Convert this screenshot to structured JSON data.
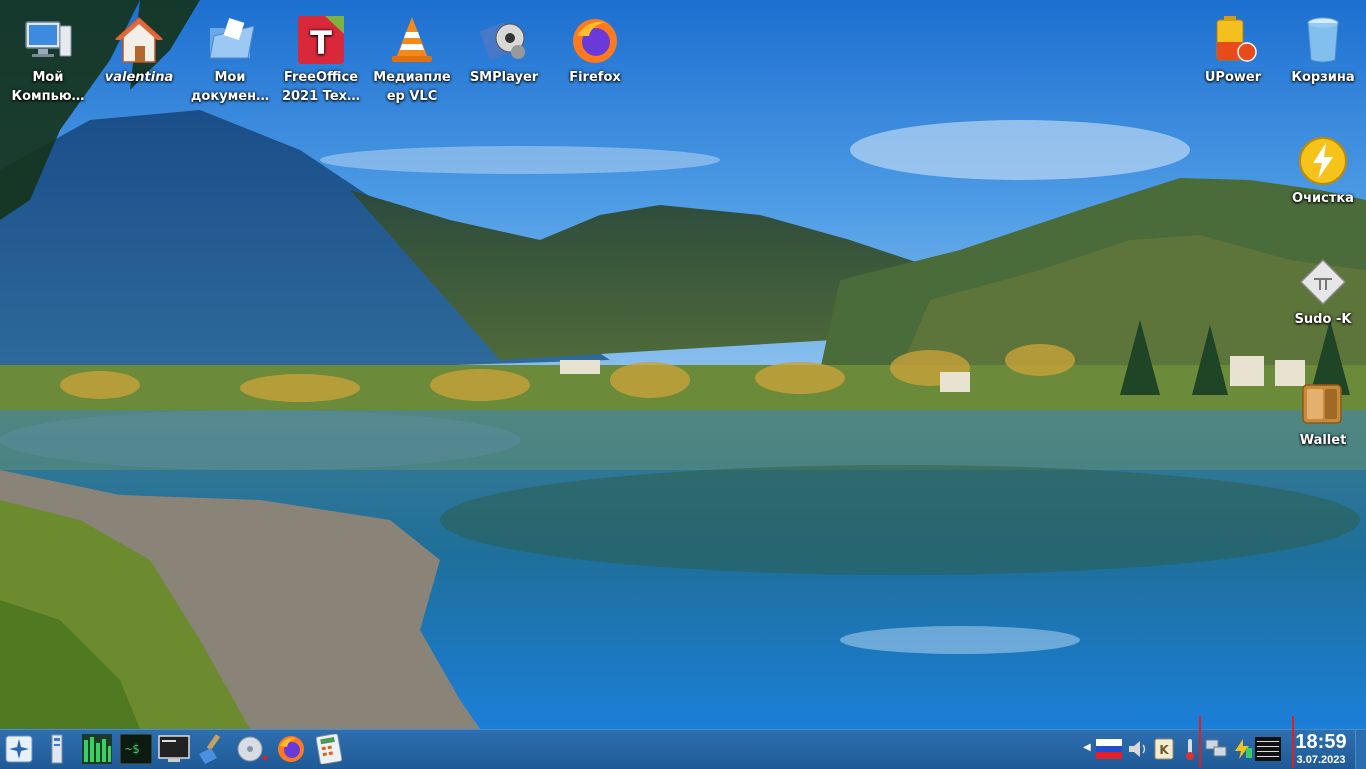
{
  "desktop": {
    "left_icons": [
      {
        "label": "Мой Компью…",
        "icon": "computer-icon"
      },
      {
        "label": "valentina",
        "icon": "home-folder-icon"
      },
      {
        "label": "Мои докумен…",
        "icon": "documents-folder-icon"
      },
      {
        "label": "FreeOffice 2021 Tex…",
        "icon": "freeoffice-textmaker-icon",
        "badge": "FREE"
      },
      {
        "label": "Медиапле ер VLC",
        "icon": "vlc-icon"
      },
      {
        "label": "SMPlayer",
        "icon": "smplayer-icon"
      },
      {
        "label": "Firefox",
        "icon": "firefox-icon"
      }
    ],
    "right_icons": [
      {
        "label": "UPower",
        "icon": "battery-icon"
      },
      {
        "label": "Корзина",
        "icon": "trash-icon"
      },
      {
        "label": "Очистка",
        "icon": "cleanup-icon"
      },
      {
        "label": "Sudo -K",
        "icon": "sudo-icon"
      },
      {
        "label": "Wallet",
        "icon": "wallet-icon"
      }
    ]
  },
  "taskbar": {
    "launchers": [
      {
        "name": "start-menu-icon"
      },
      {
        "name": "file-manager-icon"
      },
      {
        "name": "system-monitor-icon"
      },
      {
        "name": "terminal-icon",
        "text": "~$"
      },
      {
        "name": "console-icon"
      },
      {
        "name": "cleaner-brush-icon"
      },
      {
        "name": "disk-icon"
      },
      {
        "name": "firefox-icon"
      },
      {
        "name": "calculator-icon"
      }
    ],
    "tray": [
      {
        "name": "russia-flag-icon"
      },
      {
        "name": "volume-icon"
      },
      {
        "name": "keyboard-k-icon",
        "text": "K"
      },
      {
        "name": "thermometer-icon"
      },
      {
        "name": "network-icon"
      },
      {
        "name": "power-icon"
      },
      {
        "name": "cpu-graph-icon"
      }
    ],
    "clock": {
      "time": "18:59",
      "date": "3.07.2023"
    }
  },
  "colors": {
    "taskbar": "#2265a3",
    "label_text": "#ffffff"
  }
}
